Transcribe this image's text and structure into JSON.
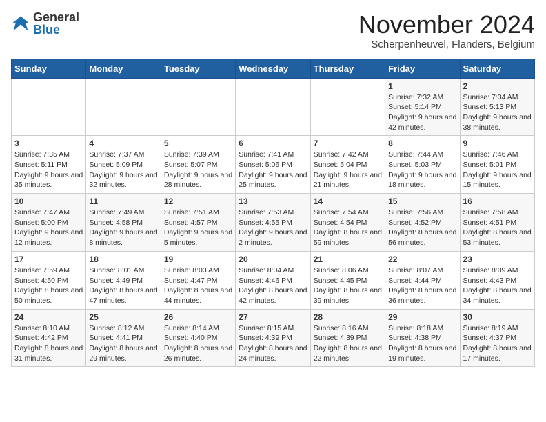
{
  "header": {
    "logo_general": "General",
    "logo_blue": "Blue",
    "month_title": "November 2024",
    "location": "Scherpenheuvel, Flanders, Belgium"
  },
  "days_of_week": [
    "Sunday",
    "Monday",
    "Tuesday",
    "Wednesday",
    "Thursday",
    "Friday",
    "Saturday"
  ],
  "weeks": [
    [
      {
        "day": "",
        "info": ""
      },
      {
        "day": "",
        "info": ""
      },
      {
        "day": "",
        "info": ""
      },
      {
        "day": "",
        "info": ""
      },
      {
        "day": "",
        "info": ""
      },
      {
        "day": "1",
        "info": "Sunrise: 7:32 AM\nSunset: 5:14 PM\nDaylight: 9 hours and 42 minutes."
      },
      {
        "day": "2",
        "info": "Sunrise: 7:34 AM\nSunset: 5:13 PM\nDaylight: 9 hours and 38 minutes."
      }
    ],
    [
      {
        "day": "3",
        "info": "Sunrise: 7:35 AM\nSunset: 5:11 PM\nDaylight: 9 hours and 35 minutes."
      },
      {
        "day": "4",
        "info": "Sunrise: 7:37 AM\nSunset: 5:09 PM\nDaylight: 9 hours and 32 minutes."
      },
      {
        "day": "5",
        "info": "Sunrise: 7:39 AM\nSunset: 5:07 PM\nDaylight: 9 hours and 28 minutes."
      },
      {
        "day": "6",
        "info": "Sunrise: 7:41 AM\nSunset: 5:06 PM\nDaylight: 9 hours and 25 minutes."
      },
      {
        "day": "7",
        "info": "Sunrise: 7:42 AM\nSunset: 5:04 PM\nDaylight: 9 hours and 21 minutes."
      },
      {
        "day": "8",
        "info": "Sunrise: 7:44 AM\nSunset: 5:03 PM\nDaylight: 9 hours and 18 minutes."
      },
      {
        "day": "9",
        "info": "Sunrise: 7:46 AM\nSunset: 5:01 PM\nDaylight: 9 hours and 15 minutes."
      }
    ],
    [
      {
        "day": "10",
        "info": "Sunrise: 7:47 AM\nSunset: 5:00 PM\nDaylight: 9 hours and 12 minutes."
      },
      {
        "day": "11",
        "info": "Sunrise: 7:49 AM\nSunset: 4:58 PM\nDaylight: 9 hours and 8 minutes."
      },
      {
        "day": "12",
        "info": "Sunrise: 7:51 AM\nSunset: 4:57 PM\nDaylight: 9 hours and 5 minutes."
      },
      {
        "day": "13",
        "info": "Sunrise: 7:53 AM\nSunset: 4:55 PM\nDaylight: 9 hours and 2 minutes."
      },
      {
        "day": "14",
        "info": "Sunrise: 7:54 AM\nSunset: 4:54 PM\nDaylight: 8 hours and 59 minutes."
      },
      {
        "day": "15",
        "info": "Sunrise: 7:56 AM\nSunset: 4:52 PM\nDaylight: 8 hours and 56 minutes."
      },
      {
        "day": "16",
        "info": "Sunrise: 7:58 AM\nSunset: 4:51 PM\nDaylight: 8 hours and 53 minutes."
      }
    ],
    [
      {
        "day": "17",
        "info": "Sunrise: 7:59 AM\nSunset: 4:50 PM\nDaylight: 8 hours and 50 minutes."
      },
      {
        "day": "18",
        "info": "Sunrise: 8:01 AM\nSunset: 4:49 PM\nDaylight: 8 hours and 47 minutes."
      },
      {
        "day": "19",
        "info": "Sunrise: 8:03 AM\nSunset: 4:47 PM\nDaylight: 8 hours and 44 minutes."
      },
      {
        "day": "20",
        "info": "Sunrise: 8:04 AM\nSunset: 4:46 PM\nDaylight: 8 hours and 42 minutes."
      },
      {
        "day": "21",
        "info": "Sunrise: 8:06 AM\nSunset: 4:45 PM\nDaylight: 8 hours and 39 minutes."
      },
      {
        "day": "22",
        "info": "Sunrise: 8:07 AM\nSunset: 4:44 PM\nDaylight: 8 hours and 36 minutes."
      },
      {
        "day": "23",
        "info": "Sunrise: 8:09 AM\nSunset: 4:43 PM\nDaylight: 8 hours and 34 minutes."
      }
    ],
    [
      {
        "day": "24",
        "info": "Sunrise: 8:10 AM\nSunset: 4:42 PM\nDaylight: 8 hours and 31 minutes."
      },
      {
        "day": "25",
        "info": "Sunrise: 8:12 AM\nSunset: 4:41 PM\nDaylight: 8 hours and 29 minutes."
      },
      {
        "day": "26",
        "info": "Sunrise: 8:14 AM\nSunset: 4:40 PM\nDaylight: 8 hours and 26 minutes."
      },
      {
        "day": "27",
        "info": "Sunrise: 8:15 AM\nSunset: 4:39 PM\nDaylight: 8 hours and 24 minutes."
      },
      {
        "day": "28",
        "info": "Sunrise: 8:16 AM\nSunset: 4:39 PM\nDaylight: 8 hours and 22 minutes."
      },
      {
        "day": "29",
        "info": "Sunrise: 8:18 AM\nSunset: 4:38 PM\nDaylight: 8 hours and 19 minutes."
      },
      {
        "day": "30",
        "info": "Sunrise: 8:19 AM\nSunset: 4:37 PM\nDaylight: 8 hours and 17 minutes."
      }
    ]
  ]
}
